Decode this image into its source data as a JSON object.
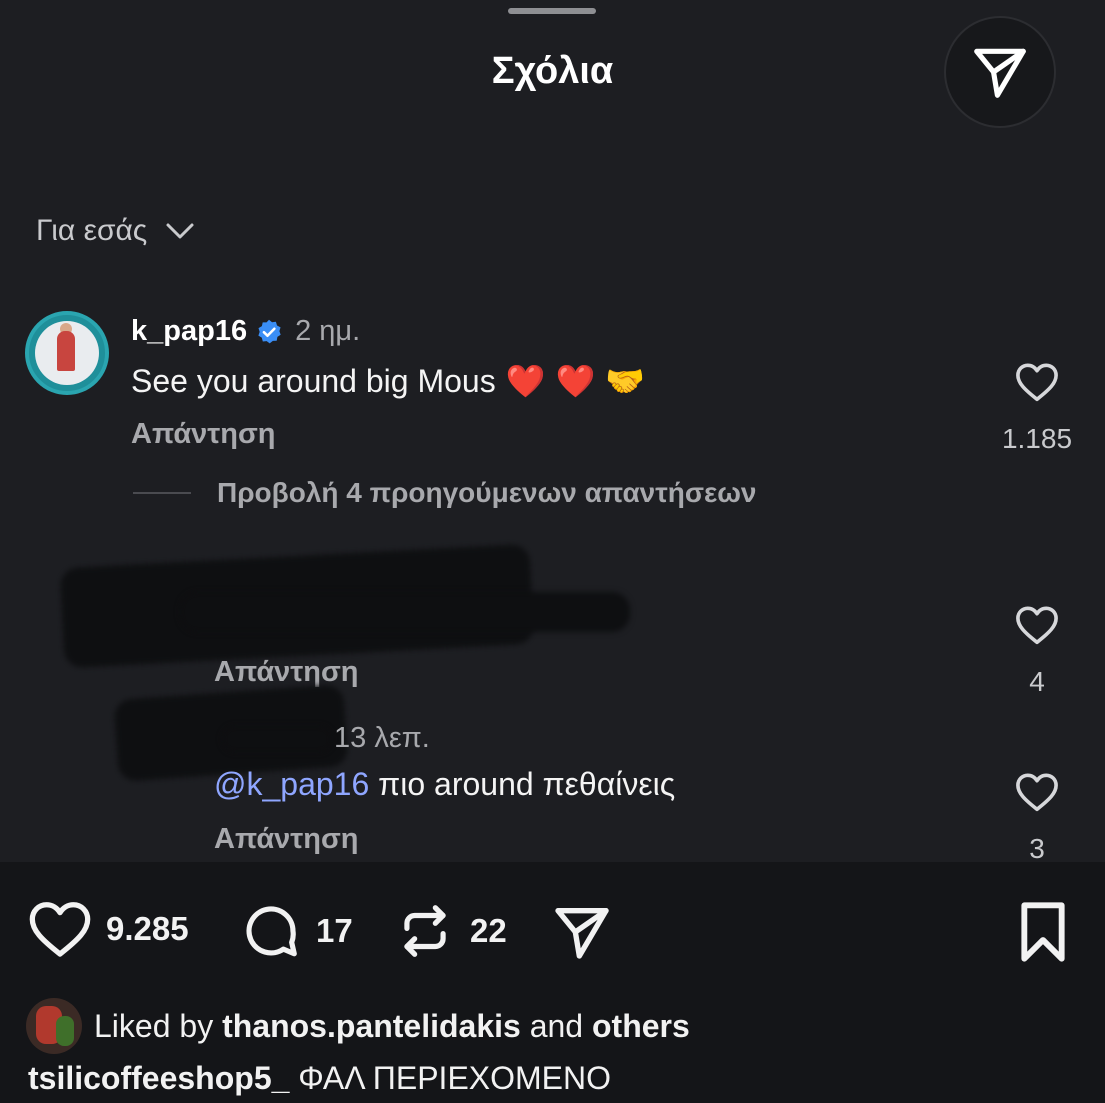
{
  "header": {
    "title": "Σχόλια"
  },
  "sort": {
    "label": "Για εσάς"
  },
  "comment": {
    "username": "k_pap16",
    "time": "2 ημ.",
    "text": "See you around big Mous",
    "emojis": [
      "❤️",
      "❤️",
      "🤝"
    ],
    "reply_label": "Απάντηση",
    "likes": "1.185"
  },
  "view_replies": {
    "label": "Προβολή 4 προηγούμενων απαντήσεων"
  },
  "replies": [
    {
      "reply_label": "Απάντηση",
      "likes": "4"
    },
    {
      "time": "13 λεπ.",
      "mention": "@k_pap16",
      "text": " πιο around πεθαίνεις",
      "reply_label": "Απάντηση",
      "likes": "3"
    }
  ],
  "actions": {
    "likes": "9.285",
    "comments": "17",
    "reposts": "22"
  },
  "liked_by": {
    "prefix": "Liked by ",
    "user": "thanos.pantelidakis",
    "middle": " and ",
    "others": "others"
  },
  "caption": {
    "username": "tsilicoffeeshop5_",
    "text": " ΦΑΛ ΠΕΡΙΕΧΟΜΕΝΟ"
  },
  "colors": {
    "sheet_bg": "#1d1e22",
    "page_bg": "#141518",
    "verified_badge": "#3a8ef6",
    "mention": "#8fa6ff"
  }
}
